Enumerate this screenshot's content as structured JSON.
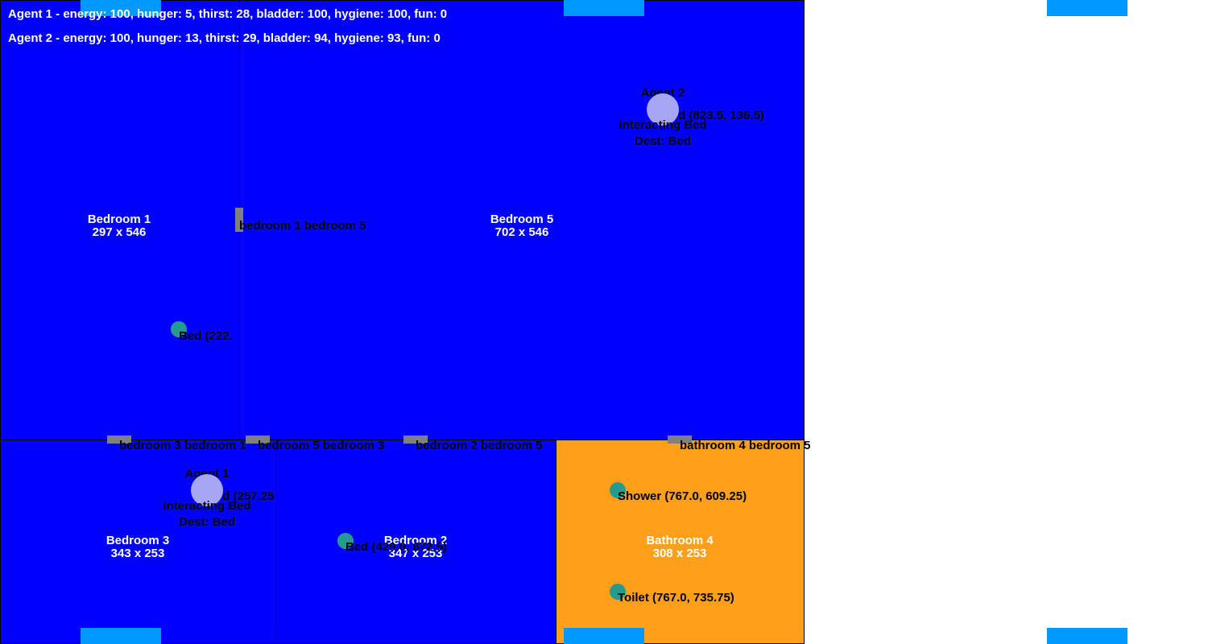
{
  "status": {
    "agent1": "Agent 1 - energy: 100, hunger: 5, thirst: 28, bladder: 100, hygiene: 100, fun: 0",
    "agent2": "Agent 2 - energy: 100, hunger: 13, thirst: 29, bladder: 94, hygiene: 93, fun: 0"
  },
  "rooms": {
    "bedroom1": {
      "name": "Bedroom 1",
      "size": "297 x 546",
      "color": "#0000ff"
    },
    "bedroom5": {
      "name": "Bedroom 5",
      "size": "702 x 546",
      "color": "#0000ff"
    },
    "bedroom3": {
      "name": "Bedroom 3",
      "size": "343 x 253",
      "color": "#0000ff"
    },
    "bedroom2": {
      "name": "Bedroom 2",
      "size": "347 x 253",
      "color": "#0000ff"
    },
    "bathroom4": {
      "name": "Bathroom 4",
      "size": "308 x 253",
      "color": "#ff9f1a"
    }
  },
  "doors": {
    "b1_b5": "bedroom 1 bedroom 5",
    "b3_b1": "bedroom 3 bedroom 1",
    "b5_b3": "bedroom 5 bedroom 3",
    "b2_b5": "bedroom 2 bedroom 5",
    "bath4_b5": "bathroom 4 bedroom 5"
  },
  "objects": {
    "bed_b1": "Bed (222.",
    "bed_b5": "Bed (823.5, 136.5)",
    "bed_b3": "Bed (257.25",
    "bed_b2": "Bed (429.0, 672.5)",
    "shower": "Shower (767.0, 609.25)",
    "toilet": "Toilet (767.0, 735.75)"
  },
  "agents": {
    "agent1": {
      "name": "Agent 1",
      "state": "interacting Bed",
      "dest": "Dest: Bed"
    },
    "agent2": {
      "name": "Agent 2",
      "state": "interacting Bed",
      "dest": "Dest: Bed"
    }
  },
  "colors": {
    "window": "#0099ff",
    "door": "#808080",
    "object": "#259a8e",
    "agent": "#a6a6f5"
  }
}
